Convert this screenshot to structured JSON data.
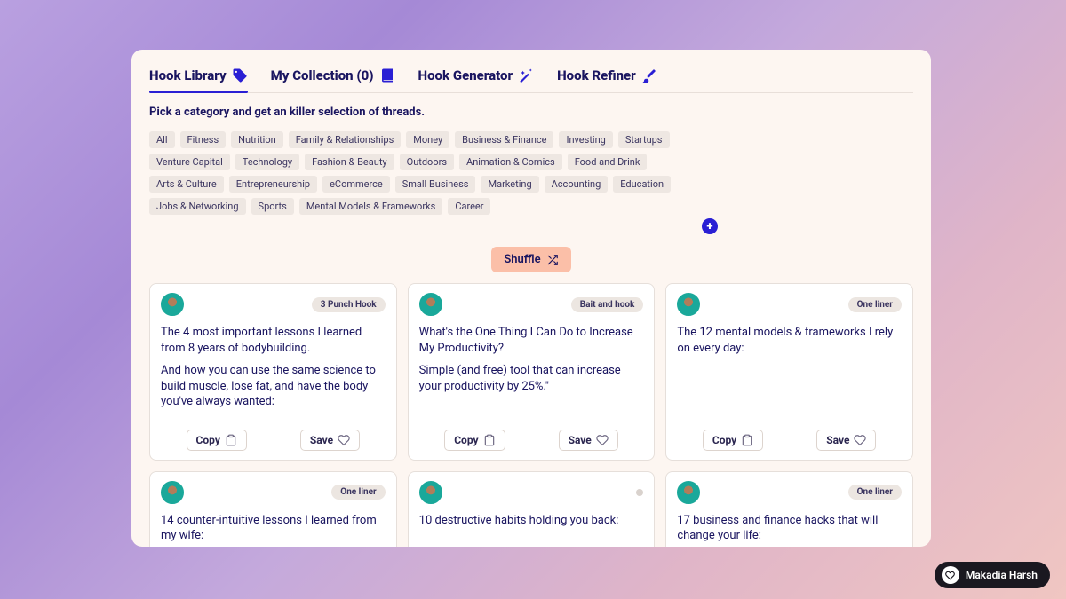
{
  "tabs": [
    {
      "label": "Hook Library",
      "icon": "tag",
      "active": true
    },
    {
      "label": "My Collection (0)",
      "icon": "book",
      "active": false
    },
    {
      "label": "Hook Generator",
      "icon": "wand",
      "active": false
    },
    {
      "label": "Hook Refiner",
      "icon": "brush",
      "active": false
    }
  ],
  "subtitle": "Pick a category and get an killer selection of threads.",
  "categories": [
    "All",
    "Fitness",
    "Nutrition",
    "Family & Relationships",
    "Money",
    "Business & Finance",
    "Investing",
    "Startups",
    "Venture Capital",
    "Technology",
    "Fashion & Beauty",
    "Outdoors",
    "Animation & Comics",
    "Food and Drink",
    "Arts & Culture",
    "Entrepreneurship",
    "eCommerce",
    "Small Business",
    "Marketing",
    "Accounting",
    "Education",
    "Jobs & Networking",
    "Sports",
    "Mental Models & Frameworks",
    "Career"
  ],
  "shuffle_label": "Shuffle",
  "copy_label": "Copy",
  "save_label": "Save",
  "cards": [
    {
      "badge": "3 Punch Hook",
      "paras": [
        "The 4 most important lessons I learned from 8 years of bodybuilding.",
        "And how you can use the same science to build muscle, lose fat, and have the body you've always wanted:"
      ]
    },
    {
      "badge": "Bait and hook",
      "paras": [
        "What's the One Thing I Can Do to Increase My Productivity?",
        "Simple (and free) tool that can increase your productivity by 25%.\""
      ]
    },
    {
      "badge": "One liner",
      "paras": [
        "The 12 mental models & frameworks I rely on every day:"
      ]
    },
    {
      "badge": "One liner",
      "paras": [
        "14 counter-intuitive lessons I learned from my wife:"
      ]
    },
    {
      "badge": "",
      "paras": [
        "10 destructive habits holding you back:"
      ]
    },
    {
      "badge": "One liner",
      "paras": [
        "17 business and finance hacks that will change your life:"
      ]
    }
  ],
  "user_pill": "Makadia Harsh"
}
